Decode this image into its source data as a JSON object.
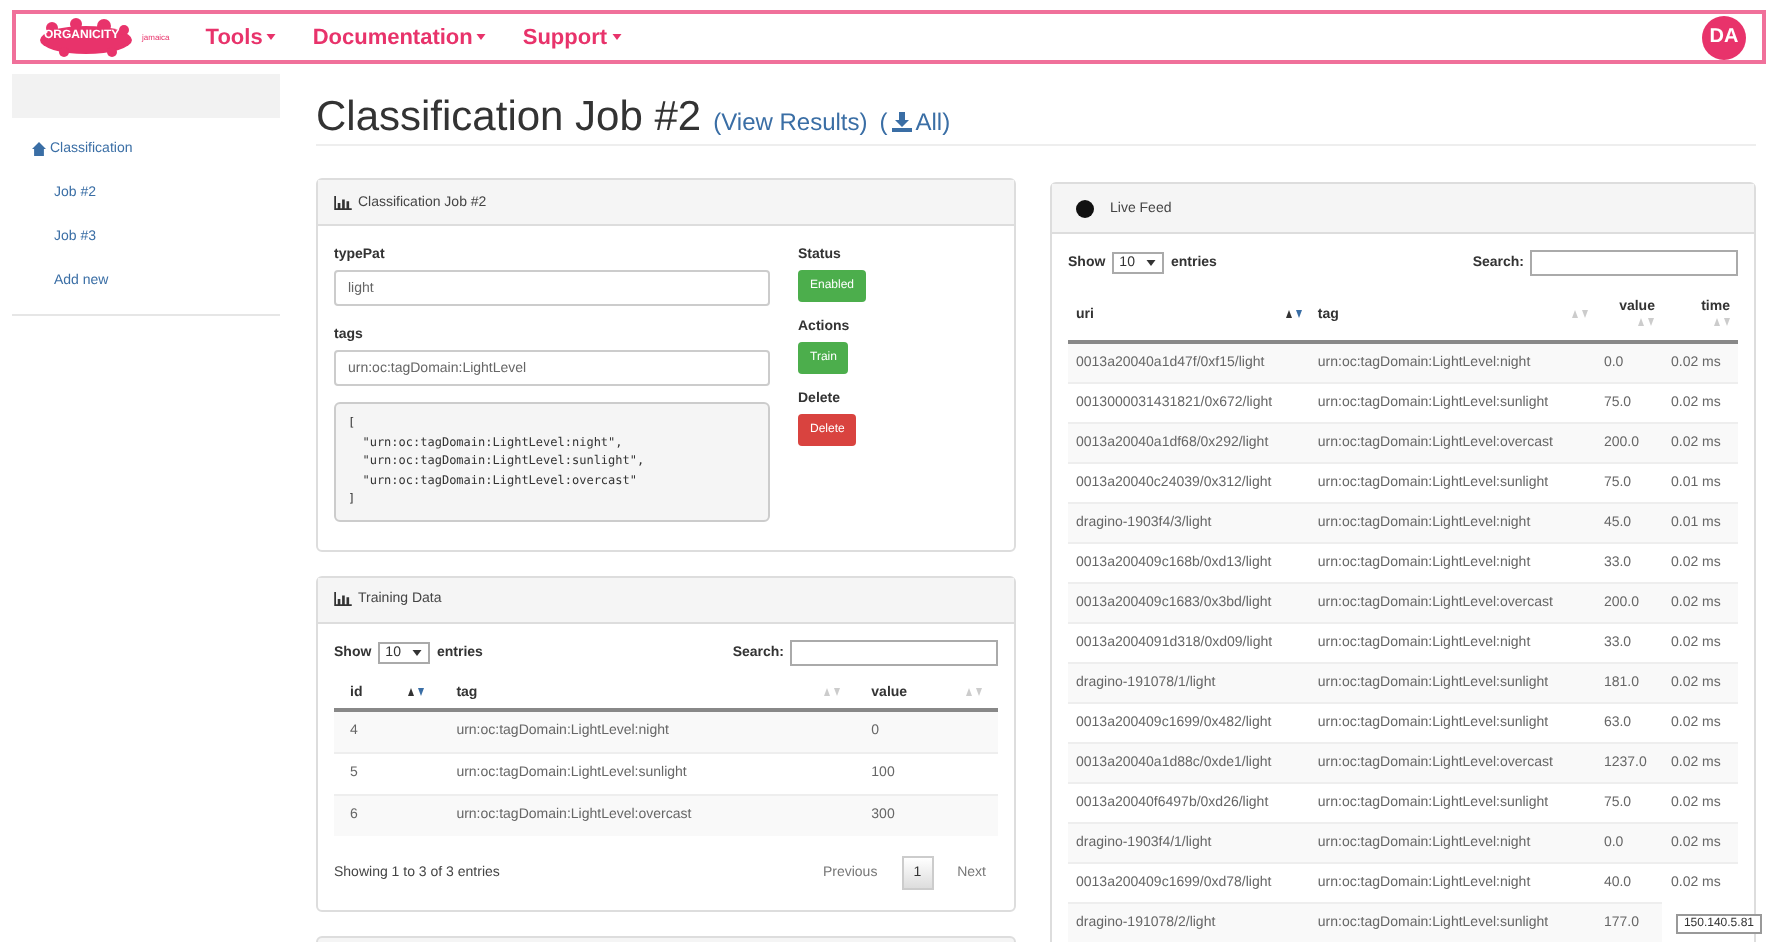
{
  "navbar": {
    "logo_text": "ORGANICITY",
    "logo_sub": "jamaica",
    "menus": [
      {
        "label": "Tools"
      },
      {
        "label": "Documentation"
      },
      {
        "label": "Support"
      }
    ],
    "avatar": "DA"
  },
  "sidebar": {
    "items": [
      {
        "label": "Classification",
        "children": [
          {
            "label": "Job #2"
          },
          {
            "label": "Job #3"
          },
          {
            "label": "Add new"
          }
        ]
      }
    ]
  },
  "page_title": "Classification Job #2",
  "title_links": [
    {
      "before": "(",
      "label": "View Results",
      "after": ")"
    },
    {
      "before": "(",
      "label": "All",
      "after": ")"
    }
  ],
  "job_panel": {
    "title": "Classification Job #2",
    "fields": [
      {
        "label": "typePat",
        "value": "light"
      },
      {
        "label": "tags",
        "value": "urn:oc:tagDomain:LightLevel"
      }
    ],
    "code_lines": [
      "[",
      "  \"urn:oc:tagDomain:LightLevel:night\",",
      "  \"urn:oc:tagDomain:LightLevel:sunlight\",",
      "  \"urn:oc:tagDomain:LightLevel:overcast\"",
      "]"
    ],
    "actions": [
      {
        "label": "Status",
        "button": "Enabled",
        "kind": "success"
      },
      {
        "label": "Actions",
        "button": "Train",
        "kind": "success"
      },
      {
        "label": "Delete",
        "button": "Delete",
        "kind": "danger"
      }
    ]
  },
  "training_panel": {
    "title": "Training Data",
    "show": "Show",
    "length": "10",
    "entries": "entries",
    "search": "Search:",
    "columns": [
      {
        "label": "id",
        "sorted": true
      },
      {
        "label": "tag",
        "sorted": false
      },
      {
        "label": "value",
        "sorted": false
      }
    ],
    "rows": [
      {
        "cells": [
          "4",
          "urn:oc:tagDomain:LightLevel:night",
          "0"
        ]
      },
      {
        "cells": [
          "5",
          "urn:oc:tagDomain:LightLevel:sunlight",
          "100"
        ]
      },
      {
        "cells": [
          "6",
          "urn:oc:tagDomain:LightLevel:overcast",
          "300"
        ]
      }
    ],
    "info": "Showing 1 to 3 of 3 entries",
    "pages": [
      {
        "label": "Previous",
        "selected": false
      },
      {
        "label": "1",
        "selected": true
      },
      {
        "label": "Next",
        "selected": false
      }
    ]
  },
  "live_panel": {
    "title": "Live Feed",
    "show": "Show",
    "length": "10",
    "entries": "entries",
    "search": "Search:",
    "columns": [
      {
        "label": "uri",
        "sorted": true
      },
      {
        "label": "tag",
        "sorted": false
      },
      {
        "label": "value",
        "sorted": false
      },
      {
        "label": "time",
        "sorted": false
      }
    ],
    "rows": [
      {
        "cells": [
          "0013a20040a1d47f/0xf15/light",
          "urn:oc:tagDomain:LightLevel:night",
          "0.0",
          "0.02 ms"
        ]
      },
      {
        "cells": [
          "0013000031431821/0x672/light",
          "urn:oc:tagDomain:LightLevel:sunlight",
          "75.0",
          "0.02 ms"
        ]
      },
      {
        "cells": [
          "0013a20040a1df68/0x292/light",
          "urn:oc:tagDomain:LightLevel:overcast",
          "200.0",
          "0.02 ms"
        ]
      },
      {
        "cells": [
          "0013a20040c24039/0x312/light",
          "urn:oc:tagDomain:LightLevel:sunlight",
          "75.0",
          "0.01 ms"
        ]
      },
      {
        "cells": [
          "dragino-1903f4/3/light",
          "urn:oc:tagDomain:LightLevel:night",
          "45.0",
          "0.01 ms"
        ]
      },
      {
        "cells": [
          "0013a200409c168b/0xd13/light",
          "urn:oc:tagDomain:LightLevel:night",
          "33.0",
          "0.02 ms"
        ]
      },
      {
        "cells": [
          "0013a200409c1683/0x3bd/light",
          "urn:oc:tagDomain:LightLevel:overcast",
          "200.0",
          "0.02 ms"
        ]
      },
      {
        "cells": [
          "0013a2004091d318/0xd09/light",
          "urn:oc:tagDomain:LightLevel:night",
          "33.0",
          "0.02 ms"
        ]
      },
      {
        "cells": [
          "dragino-191078/1/light",
          "urn:oc:tagDomain:LightLevel:sunlight",
          "181.0",
          "0.02 ms"
        ]
      },
      {
        "cells": [
          "0013a200409c1699/0x482/light",
          "urn:oc:tagDomain:LightLevel:sunlight",
          "63.0",
          "0.02 ms"
        ]
      },
      {
        "cells": [
          "0013a20040a1d88c/0xde1/light",
          "urn:oc:tagDomain:LightLevel:overcast",
          "1237.0",
          "0.02 ms"
        ]
      },
      {
        "cells": [
          "0013a20040f6497b/0xd26/light",
          "urn:oc:tagDomain:LightLevel:sunlight",
          "75.0",
          "0.02 ms"
        ]
      },
      {
        "cells": [
          "dragino-1903f4/1/light",
          "urn:oc:tagDomain:LightLevel:night",
          "0.0",
          "0.02 ms"
        ]
      },
      {
        "cells": [
          "0013a200409c1699/0xd78/light",
          "urn:oc:tagDomain:LightLevel:night",
          "40.0",
          "0.02 ms"
        ]
      },
      {
        "cells": [
          "dragino-191078/2/light",
          "urn:oc:tagDomain:LightLevel:sunlight",
          "177.0"
        ]
      }
    ]
  },
  "tooltip": "150.140.5.81"
}
